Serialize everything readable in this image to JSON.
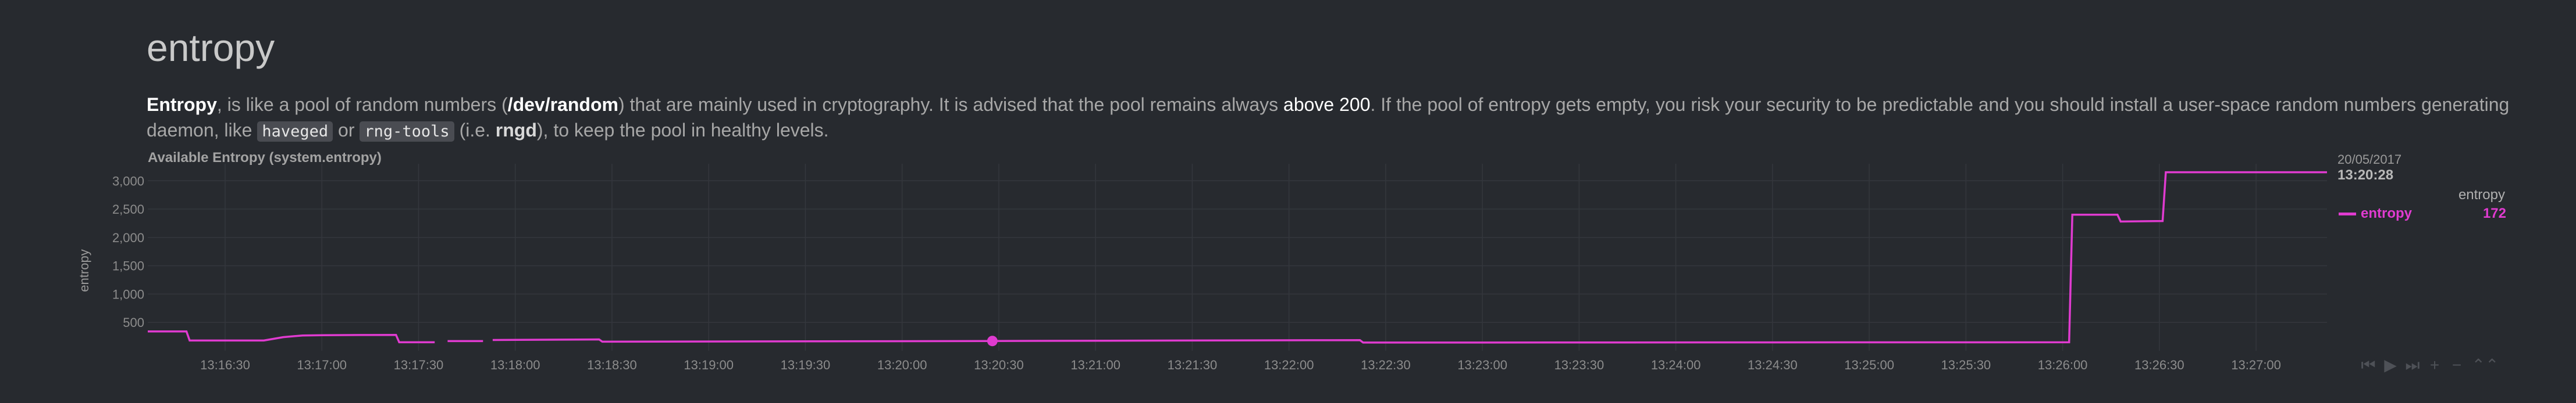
{
  "section": {
    "title": "entropy",
    "desc": {
      "p1": "Entropy",
      "p2": ", is like a pool of random numbers (",
      "p3": "/dev/random",
      "p4": ") that are mainly used in cryptography. It is advised that the pool remains always ",
      "p5": "above 200",
      "p6": ". If the pool of entropy gets empty, you risk your security to be predictable and you should install a user-space random numbers generating daemon, like ",
      "p7": "haveged",
      "p8": " or ",
      "p9": "rng-tools",
      "p10": " (i.e. ",
      "p11": "rngd",
      "p12": "), to keep the pool in healthy levels."
    }
  },
  "chart": {
    "title": "Available Entropy (system.entropy)",
    "ylabel": "entropy",
    "legend": {
      "date": "20/05/2017",
      "time": "13:20:28",
      "header": "entropy",
      "series_name": "entropy",
      "series_value": "172"
    },
    "controls": [
      "⏮",
      "▶",
      "⏭",
      "+",
      "−",
      "⌃⌃"
    ]
  },
  "colors": {
    "series": "#e03bd0",
    "background": "#272a2f",
    "grid": "#34373d"
  },
  "chart_data": {
    "type": "line",
    "title": "Available Entropy (system.entropy)",
    "xlabel": "",
    "ylabel": "entropy",
    "ylim": [
      0,
      3300
    ],
    "xlim_seconds": [
      "13:16:06",
      "13:27:22"
    ],
    "yticks": [
      500,
      1000,
      1500,
      2000,
      2500,
      3000
    ],
    "ytick_labels": [
      "500",
      "1,000",
      "1,500",
      "2,000",
      "2,500",
      "3,000"
    ],
    "xticks": [
      "13:16:30",
      "13:17:00",
      "13:17:30",
      "13:18:00",
      "13:18:30",
      "13:19:00",
      "13:19:30",
      "13:20:00",
      "13:20:30",
      "13:21:00",
      "13:21:30",
      "13:22:00",
      "13:22:30",
      "13:23:00",
      "13:23:30",
      "13:24:00",
      "13:24:30",
      "13:25:00",
      "13:25:30",
      "13:26:00",
      "13:26:30",
      "13:27:00"
    ],
    "grid": true,
    "legend_position": "right",
    "highlight": {
      "x": "13:20:28",
      "y": 172
    },
    "series": [
      {
        "name": "entropy",
        "segments": [
          [
            [
              "13:16:06",
              340
            ],
            [
              "13:16:18",
              340
            ],
            [
              "13:16:19",
              180
            ],
            [
              "13:16:42",
              180
            ],
            [
              "13:16:48",
              240
            ],
            [
              "13:16:54",
              270
            ],
            [
              "13:17:00",
              275
            ],
            [
              "13:17:12",
              278
            ],
            [
              "13:17:23",
              280
            ],
            [
              "13:17:24",
              150
            ],
            [
              "13:17:35",
              150
            ]
          ],
          [
            [
              "13:17:39",
              170
            ],
            [
              "13:17:50",
              170
            ]
          ],
          [
            [
              "13:17:53",
              190
            ],
            [
              "13:18:26",
              200
            ],
            [
              "13:18:27",
              160
            ],
            [
              "13:19:54",
              168
            ],
            [
              "13:20:28",
              172
            ],
            [
              "13:22:06",
              185
            ],
            [
              "13:22:22",
              188
            ],
            [
              "13:22:23",
              145
            ],
            [
              "13:26:02",
              150
            ],
            [
              "13:26:03",
              2400
            ],
            [
              "13:26:17",
              2400
            ],
            [
              "13:26:18",
              2280
            ],
            [
              "13:26:31",
              2290
            ],
            [
              "13:26:32",
              3150
            ],
            [
              "13:27:22",
              3150
            ]
          ]
        ]
      }
    ]
  }
}
